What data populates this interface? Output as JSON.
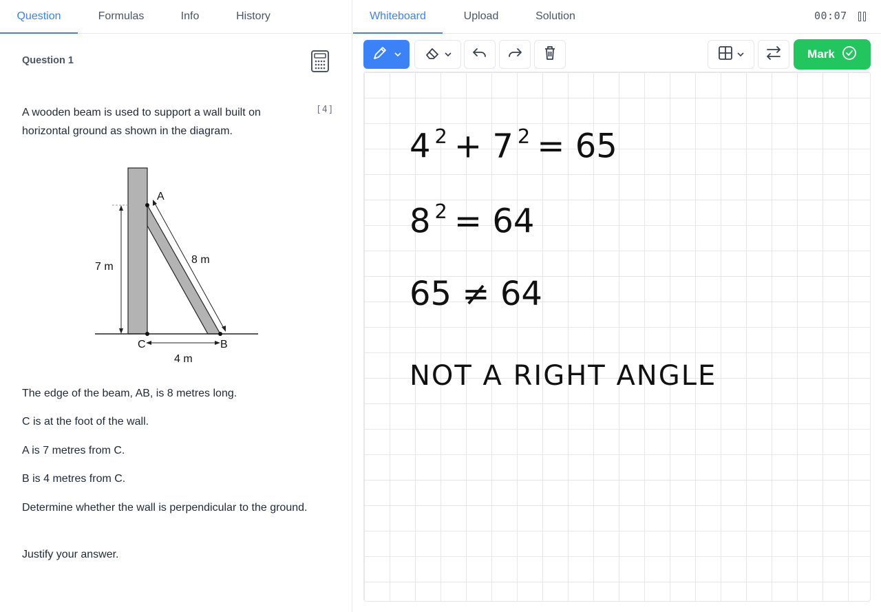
{
  "left_tabs": [
    "Question",
    "Formulas",
    "Info",
    "History"
  ],
  "right_tabs": [
    "Whiteboard",
    "Upload",
    "Solution"
  ],
  "timer": "00:07",
  "question": {
    "title": "Question 1",
    "marks": "[4]",
    "intro": "A wooden beam is used to support a wall built on horizontal ground as shown in the diagram.",
    "paragraphs": [
      "The edge of the beam, AB, is 8 metres long.",
      "C is at the foot of the wall.",
      "A is 7 metres from C.",
      "B is 4 metres from C.",
      "Determine whether the wall is perpendicular to the ground.",
      "Justify your answer."
    ]
  },
  "diagram": {
    "label_a": "A",
    "label_b": "B",
    "label_c": "C",
    "label_wall": "7 m",
    "label_beam": "8 m",
    "label_ground": "4 m"
  },
  "toolbar": {
    "mark_label": "Mark"
  },
  "whiteboard": {
    "line1_a": "4",
    "line1_a_exp": "2",
    "line1_mid": "+ 7",
    "line1_b_exp": "2",
    "line1_end": "= 65",
    "line2_a": "8",
    "line2_a_exp": "2",
    "line2_end": "= 64",
    "line3": "65 ≠ 64",
    "line4": "NOT A RIGHT ANGLE"
  },
  "colors": {
    "accent": "#3b82f6",
    "mark_button": "#22c55e",
    "grid": "#e5e7eb"
  }
}
